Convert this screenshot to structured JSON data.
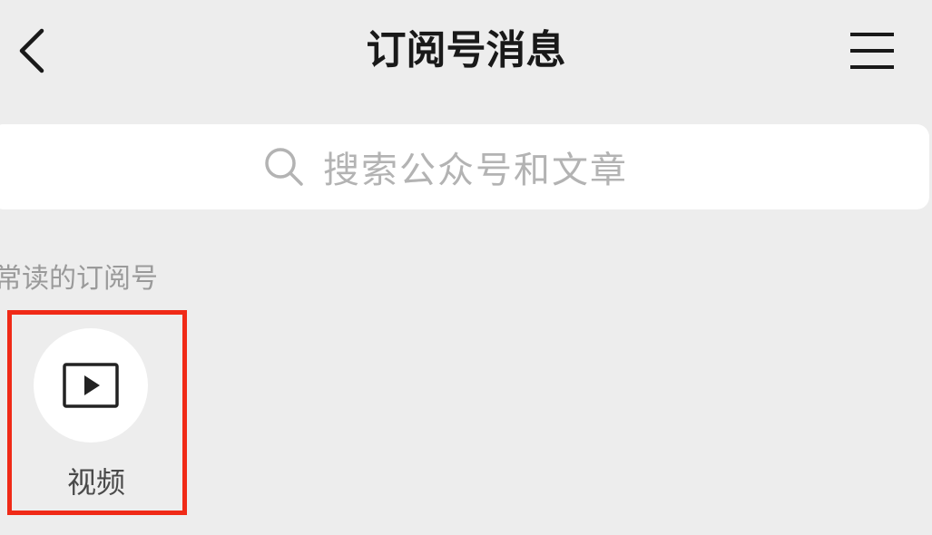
{
  "header": {
    "title": "订阅号消息",
    "back_icon": "chevron-left-icon",
    "menu_icon": "hamburger-menu-icon"
  },
  "search": {
    "placeholder": "搜索公众号和文章",
    "icon": "search-icon"
  },
  "frequent": {
    "label": "常读的订阅号",
    "items": [
      {
        "name": "视频",
        "icon": "video-play-icon",
        "highlighted": true
      }
    ]
  },
  "colors": {
    "background": "#ededed",
    "highlight": "#f02a17",
    "title": "#191919",
    "placeholder": "#b3b3b3"
  }
}
